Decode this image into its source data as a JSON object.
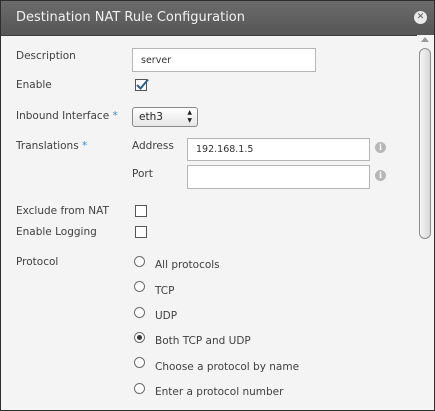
{
  "dialog": {
    "title": "Destination NAT Rule Configuration",
    "close_icon": "close-icon"
  },
  "form": {
    "description": {
      "label": "Description",
      "value": "server"
    },
    "enable": {
      "label": "Enable",
      "checked": true
    },
    "inbound_interface": {
      "label": "Inbound Interface",
      "required_mark": "*",
      "value": "eth3"
    },
    "translations": {
      "label": "Translations",
      "required_mark": "*",
      "address": {
        "label": "Address",
        "value": "192.168.1.5"
      },
      "port": {
        "label": "Port",
        "value": ""
      }
    },
    "exclude_from_nat": {
      "label": "Exclude from NAT",
      "checked": false
    },
    "enable_logging": {
      "label": "Enable Logging",
      "checked": false
    },
    "protocol": {
      "label": "Protocol",
      "options": [
        "All protocols",
        "TCP",
        "UDP",
        "Both TCP and UDP",
        "Choose a protocol by name",
        "Enter a protocol number"
      ],
      "selected": "Both TCP and UDP"
    }
  },
  "colors": {
    "titlebar": "#5e5e5e",
    "required_mark": "#3a8fd1",
    "checkbox_check": "#2a5f8f"
  }
}
